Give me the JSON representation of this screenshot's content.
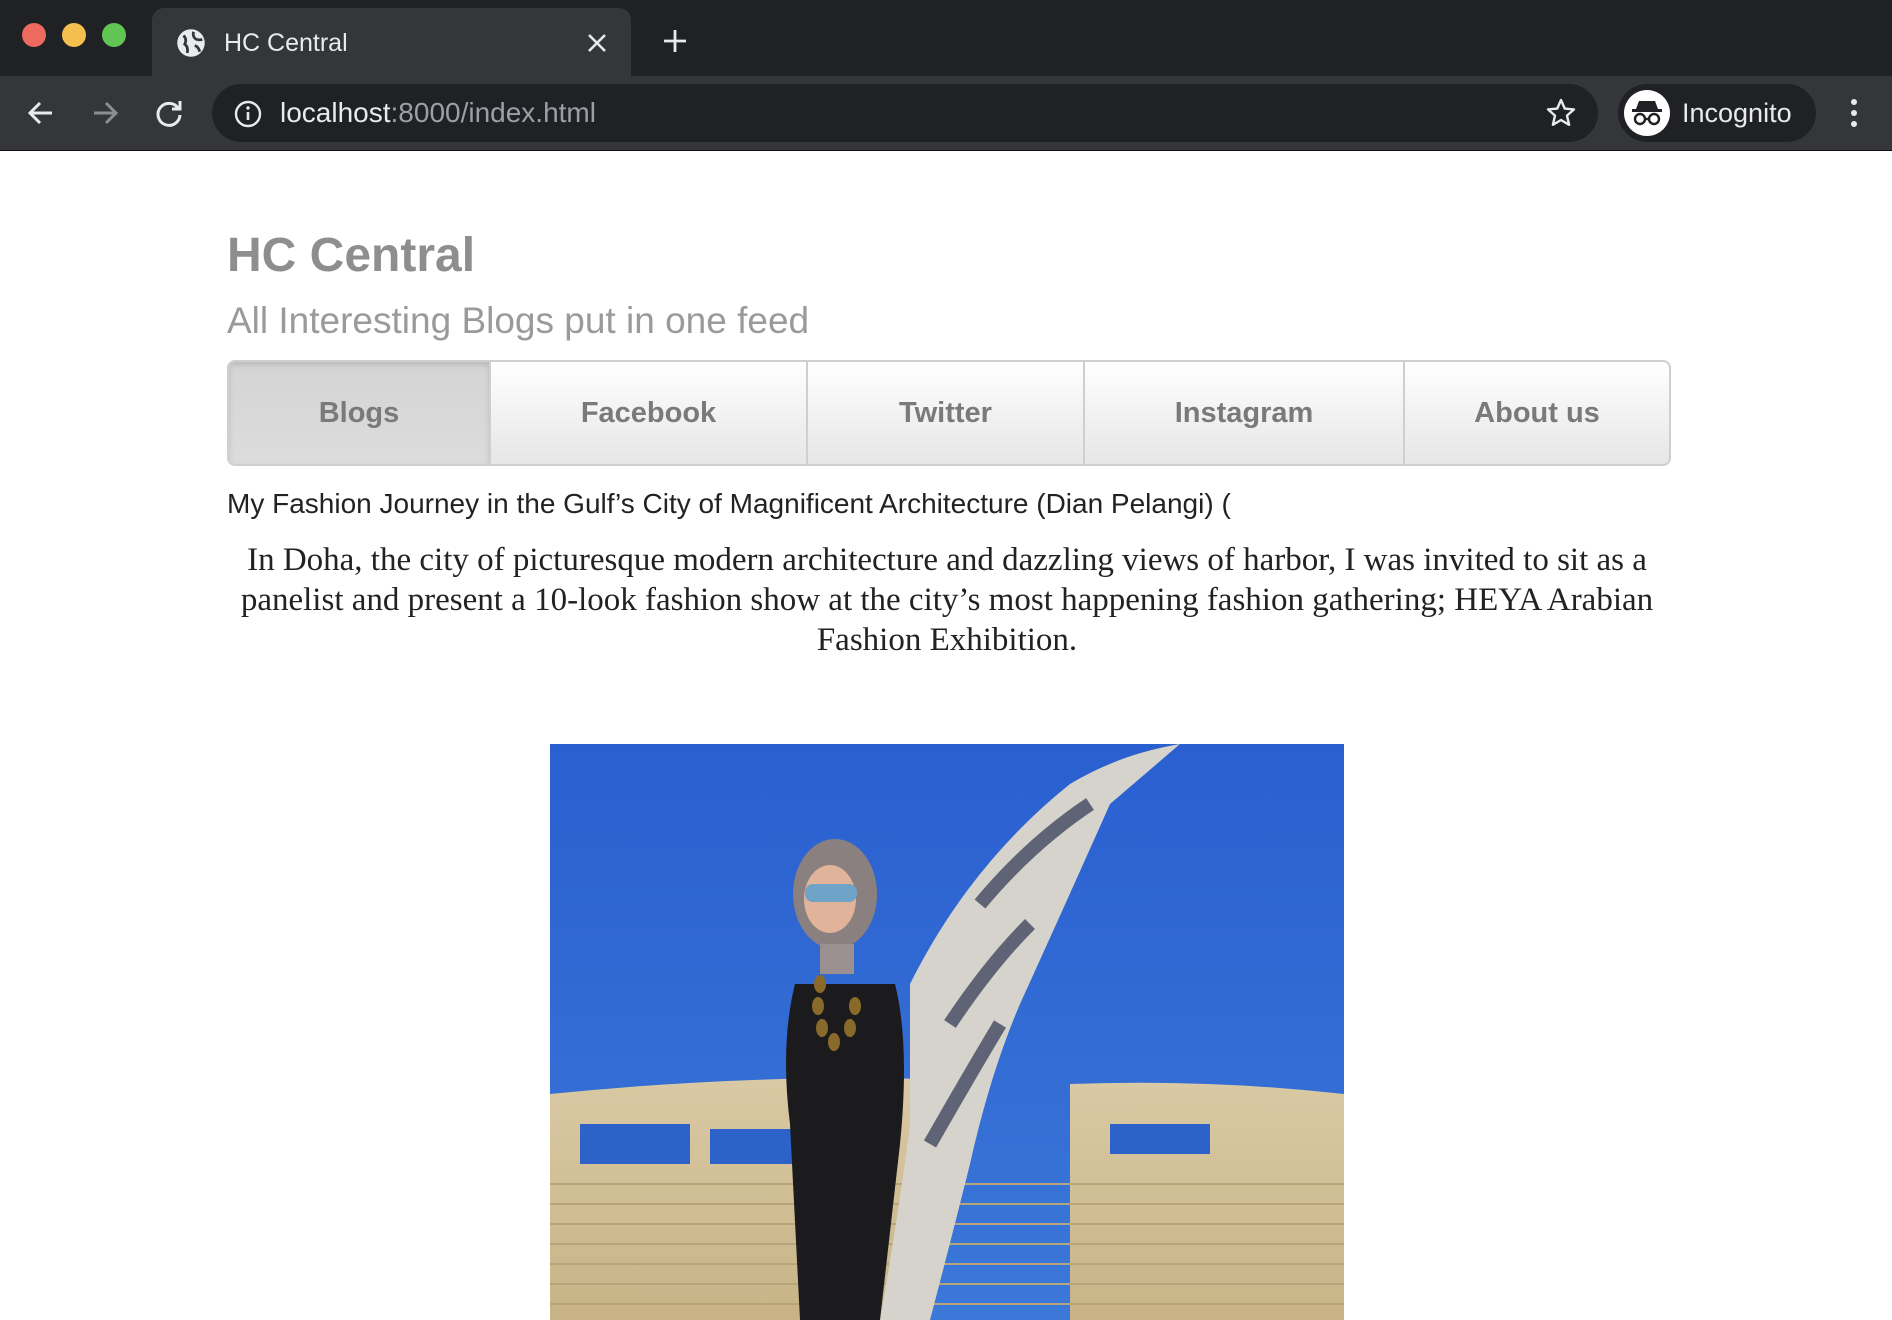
{
  "browser": {
    "tab_title": "HC Central",
    "url_host": "localhost",
    "url_rest": ":8000/index.html",
    "profile_label": "Incognito"
  },
  "site": {
    "title": "HC Central",
    "subtitle": "All Interesting Blogs put in one feed"
  },
  "nav": {
    "items": [
      {
        "label": "Blogs",
        "active": true
      },
      {
        "label": "Facebook"
      },
      {
        "label": "Twitter"
      },
      {
        "label": "Instagram"
      },
      {
        "label": "About us"
      }
    ]
  },
  "post": {
    "title": "My Fashion Journey in the Gulf’s City of Magnificent Architecture (Dian Pelangi) (",
    "excerpt": "In Doha, the city of picturesque modern architecture and dazzling views of harbor, I was invited to sit as a panelist and present a 10-look fashion show at the city’s most happening fashion gathering; HEYA Arabian Fashion Exhibition."
  },
  "colors": {
    "chrome_dark": "#202124",
    "chrome_mid": "#35363a",
    "heading_gray": "#8e8e8e",
    "sky_blue": "#2d62c8"
  }
}
